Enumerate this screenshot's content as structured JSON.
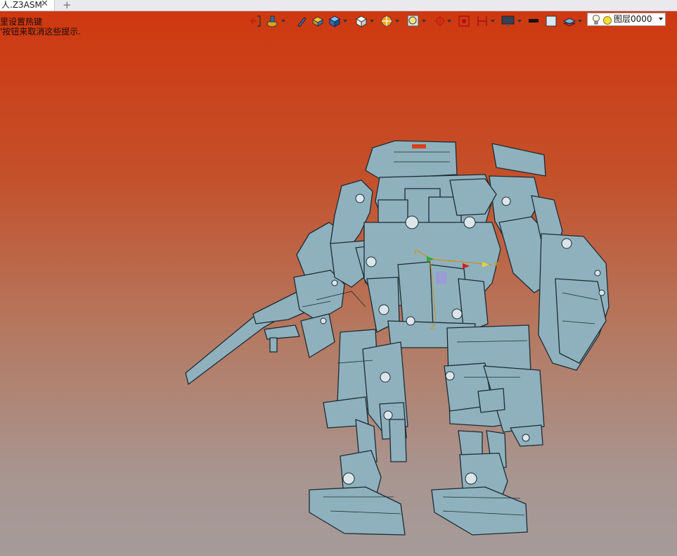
{
  "tab": {
    "title": "人.Z3ASM",
    "close_glyph": "✕",
    "add_glyph": "+"
  },
  "hints": [
    "里设置热键",
    "'按钮来取消这些提示."
  ],
  "toolbar": {
    "items": [
      "exit-icon",
      "model-tree-icon",
      "pen-icon",
      "solid-icon",
      "cube-icon",
      "view-cube-icon",
      "render-mode-icon",
      "zoom-icon",
      "origin-icon",
      "snap-icon",
      "filter-icon",
      "display-icon",
      "color-black-icon",
      "color-white-icon",
      "layer-manager-icon"
    ]
  },
  "layer": {
    "label": "图层0000"
  },
  "colors": {
    "model": "#8fb1bd",
    "outline": "#1c2b33",
    "bg_top": "#cf3810",
    "bg_bottom": "#a59b99"
  },
  "triad": {
    "y_label": "Y",
    "x_label": "X",
    "z_label": "Z"
  }
}
